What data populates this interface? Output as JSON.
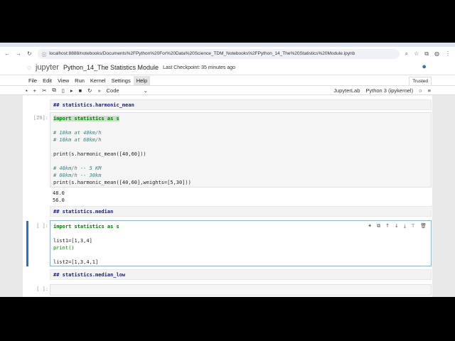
{
  "browser": {
    "url": "localhost:8888/notebooks/Documents%2FPython%20For%20Data%20Science_TDM_Notebooks%2FPython_14_The%20Statistics%20Module.ipynb"
  },
  "header": {
    "logo": "jupyter",
    "title": "Python_14_The Statistics Module",
    "checkpoint": "Last Checkpoint: 35 minutes ago"
  },
  "menu": {
    "items": [
      "File",
      "Edit",
      "View",
      "Run",
      "Kernel",
      "Settings",
      "Help"
    ],
    "trusted": "Trusted"
  },
  "toolbar": {
    "cell_type": "Code",
    "jupyterlab": "JupyterLab",
    "kernel": "Python 3 (ipykernel)"
  },
  "cells": [
    {
      "type": "markdown",
      "text": "## statistics.harmonic_mean"
    },
    {
      "type": "code",
      "prompt": "[20]:",
      "lines": [
        "import statistics as s",
        "",
        "# 10km at 40km/h",
        "# 10km at 60km/h",
        "",
        "print(s.harmonic_mean([40,60]))",
        "",
        "# 40km/h -- 5 KM",
        "# 60km/h -- 30km",
        "print(s.harmonic_mean([40,60],weights=[5,30]))"
      ],
      "outputs": [
        "48.0",
        "56.0"
      ]
    },
    {
      "type": "markdown",
      "text": "## statistics.median"
    },
    {
      "type": "code",
      "prompt": "[ ]:",
      "active": true,
      "lines": [
        "import statistics as s",
        "",
        "list1=[1,3,4]",
        "print()",
        "",
        "list2=[1,3,4,1]"
      ]
    },
    {
      "type": "markdown",
      "text": "## statistics.median_low"
    },
    {
      "type": "code",
      "prompt": "[ ]:",
      "lines": [
        ""
      ]
    }
  ],
  "colors": {
    "accent": "#1976d2",
    "jupyter_orange": "#f37726"
  }
}
